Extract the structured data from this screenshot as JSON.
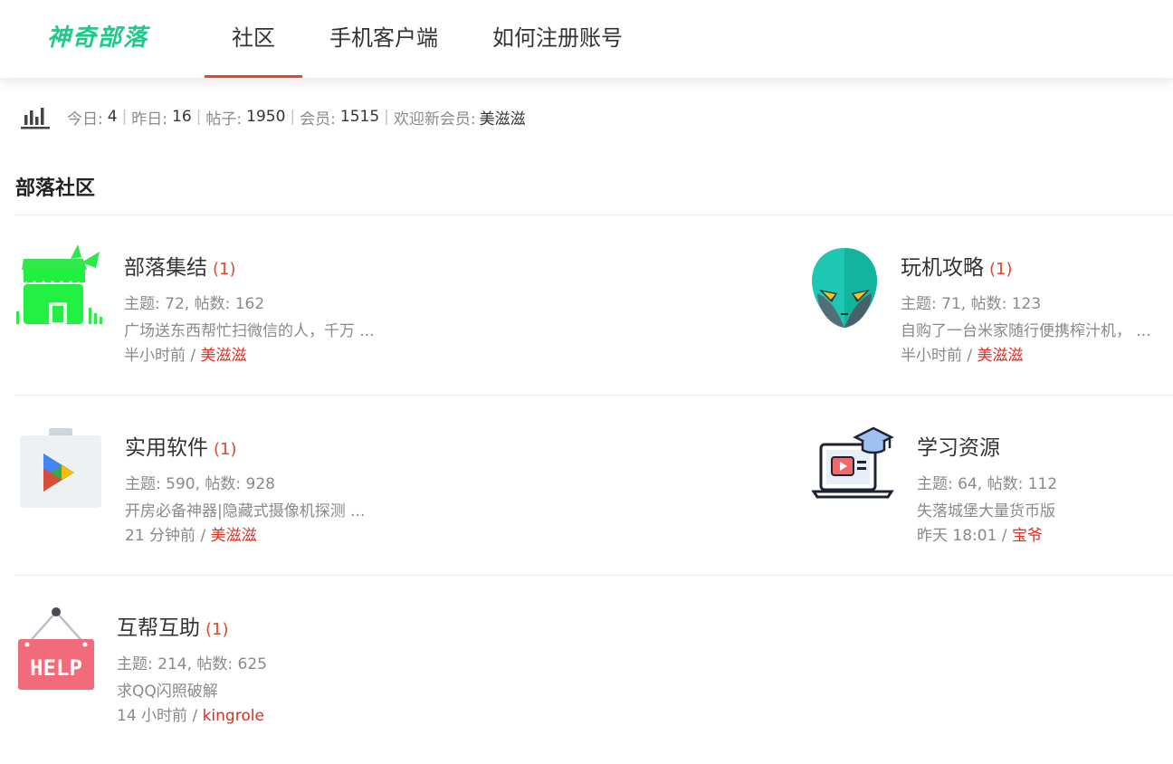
{
  "header": {
    "logo_text": "神奇部落",
    "nav": [
      {
        "label": "社区",
        "active": true
      },
      {
        "label": "手机客户端",
        "active": false
      },
      {
        "label": "如何注册账号",
        "active": false
      }
    ],
    "accent_color": "#e2462b"
  },
  "stats": {
    "today_label": "今日:",
    "today": "4",
    "yesterday_label": "昨日:",
    "yesterday": "16",
    "posts_label": "帖子:",
    "posts": "1950",
    "members_label": "会员:",
    "members": "1515",
    "welcome_label": "欢迎新会员:",
    "new_member": "美滋滋",
    "separator": "|"
  },
  "section": {
    "title": "部落社区"
  },
  "forums": [
    {
      "name": "部落集结",
      "count": "(1)",
      "stats": "主题: 72, 帖数: 162",
      "latest": "广场送东西帮忙扫微信的人，千万 ...",
      "time": "半小时前 /",
      "user": "美滋滋",
      "icon": "green-shop-icon"
    },
    {
      "name": "玩机攻略",
      "count": "(1)",
      "stats": "主题: 71, 帖数: 123",
      "latest": "自购了一台米家随行便携榨汁机，  ...",
      "time": "半小时前 /",
      "user": "美滋滋",
      "icon": "alien-head-icon"
    },
    {
      "name": "实用软件",
      "count": "(1)",
      "stats": "主题: 590, 帖数: 928",
      "latest": "开房必备神器|隐藏式摄像机探测 ...",
      "time": "21 分钟前 /",
      "user": "美滋滋",
      "icon": "play-store-bag-icon"
    },
    {
      "name": "学习资源",
      "count": "",
      "stats": "主题: 64, 帖数: 112",
      "latest": "失落城堡大量货币版",
      "time": "昨天 18:01 /",
      "user": "宝爷",
      "icon": "laptop-graduation-icon"
    },
    {
      "name": "互帮互助",
      "count": "(1)",
      "stats": "主题: 214, 帖数: 625",
      "latest": "求QQ闪照破解",
      "time": "14 小时前 /",
      "user": "kingrole",
      "icon": "help-sign-icon"
    }
  ]
}
